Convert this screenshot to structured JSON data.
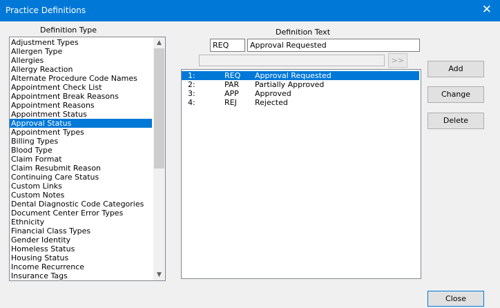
{
  "window": {
    "title": "Practice Definitions",
    "close_glyph": "✕"
  },
  "definition_type": {
    "label": "Definition Type",
    "items": [
      "Adjustment Types",
      "Allergen Type",
      "Allergies",
      "Allergy Reaction",
      "Alternate Procedure Code Names",
      "Appointment Check List",
      "Appointment Break Reasons",
      "Appointment Reasons",
      "Appointment Status",
      "Approval Status",
      "Appointment Types",
      "Billing Types",
      "Blood Type",
      "Claim Format",
      "Claim Resubmit Reason",
      "Continuing Care Status",
      "Custom Links",
      "Custom Notes",
      "Dental Diagnostic Code Categories",
      "Document Center Error Types",
      "Ethnicity",
      "Financial Class Types",
      "Gender Identity",
      "Homeless Status",
      "Housing Status",
      "Income Recurrence",
      "Insurance Tags"
    ],
    "selected_index": 9
  },
  "definition_text": {
    "label": "Definition Text",
    "code": "REQ",
    "text": "Approval Requested",
    "arrow_label": ">>"
  },
  "definitions": [
    {
      "num": "1:",
      "code": "REQ",
      "text": "Approval Requested"
    },
    {
      "num": "2:",
      "code": "PAR",
      "text": "Partially Approved"
    },
    {
      "num": "3:",
      "code": "APP",
      "text": "Approved"
    },
    {
      "num": "4:",
      "code": "REJ",
      "text": "Rejected"
    }
  ],
  "selected_definition": 0,
  "buttons": {
    "add": "Add",
    "change": "Change",
    "delete": "Delete",
    "close": "Close"
  },
  "colors": {
    "titlebar": "#0078d7",
    "selection": "#0078d7"
  }
}
